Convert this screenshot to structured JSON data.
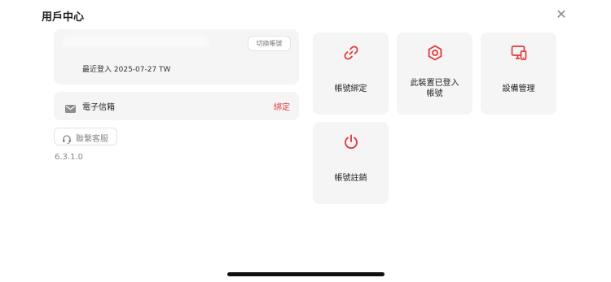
{
  "header": {
    "title": "用戶中心",
    "close_icon": "close-icon"
  },
  "account": {
    "switch_label": "切換帳號",
    "last_login_label": "最近登入",
    "last_login_value": "2025-07-27 TW"
  },
  "email": {
    "label": "電子信箱",
    "action": "綁定",
    "icon": "mail-icon"
  },
  "support": {
    "label": "聯繫客服",
    "icon": "headset-icon"
  },
  "version": "6.3.1.0",
  "tiles": [
    {
      "label": "帳號綁定",
      "icon": "link-icon"
    },
    {
      "label_line1": "此裝置已登入",
      "label_line2": "帳號",
      "icon": "hexagon-nut-icon"
    },
    {
      "label": "設備管理",
      "icon": "devices-icon"
    },
    {
      "label": "帳號註銷",
      "icon": "power-icon"
    }
  ],
  "colors": {
    "accent": "#e4383b",
    "card_bg": "#f5f5f5",
    "text": "#222222",
    "muted": "#888888"
  }
}
